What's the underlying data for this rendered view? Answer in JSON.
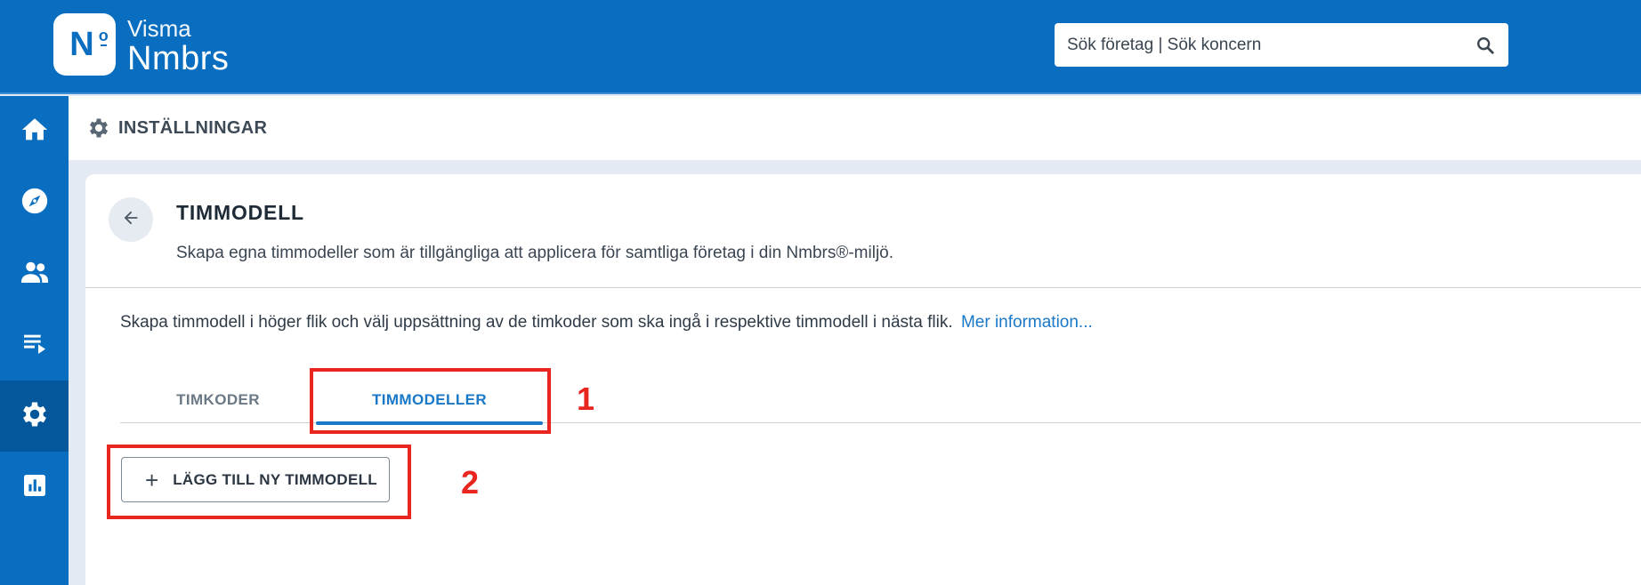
{
  "brand": {
    "top": "Visma",
    "name": "Nmbrs",
    "logo_letters": "N",
    "logo_sup": "o"
  },
  "search": {
    "placeholder": "Sök företag | Sök koncern"
  },
  "nav": [
    {
      "icon": "home-icon"
    },
    {
      "icon": "compass-icon"
    },
    {
      "icon": "people-icon"
    },
    {
      "icon": "playlist-icon"
    },
    {
      "icon": "gear-icon",
      "active": true
    },
    {
      "icon": "bar-chart-icon"
    }
  ],
  "header": {
    "title": "INSTÄLLNINGAR"
  },
  "page": {
    "title": "TIMMODELL",
    "subtitle": "Skapa egna timmodeller som är tillgängliga att applicera för samtliga företag i din Nmbrs®-miljö.",
    "info": "Skapa timmodell i höger flik och välj uppsättning av de timkoder som ska ingå i respektive timmodell i nästa flik.",
    "info_link": "Mer information..."
  },
  "tabs": [
    {
      "label": "TIMKODER"
    },
    {
      "label": "TIMMODELLER",
      "active": true
    }
  ],
  "actions": {
    "add_label": "LÄGG TILL NY TIMMODELL",
    "add_icon": "plus-icon"
  },
  "annotations": {
    "first": "1",
    "second": "2"
  },
  "colors": {
    "brand_blue": "#0a6ec0",
    "active_tab": "#1a78c8",
    "annotation_red": "#e8251f"
  }
}
